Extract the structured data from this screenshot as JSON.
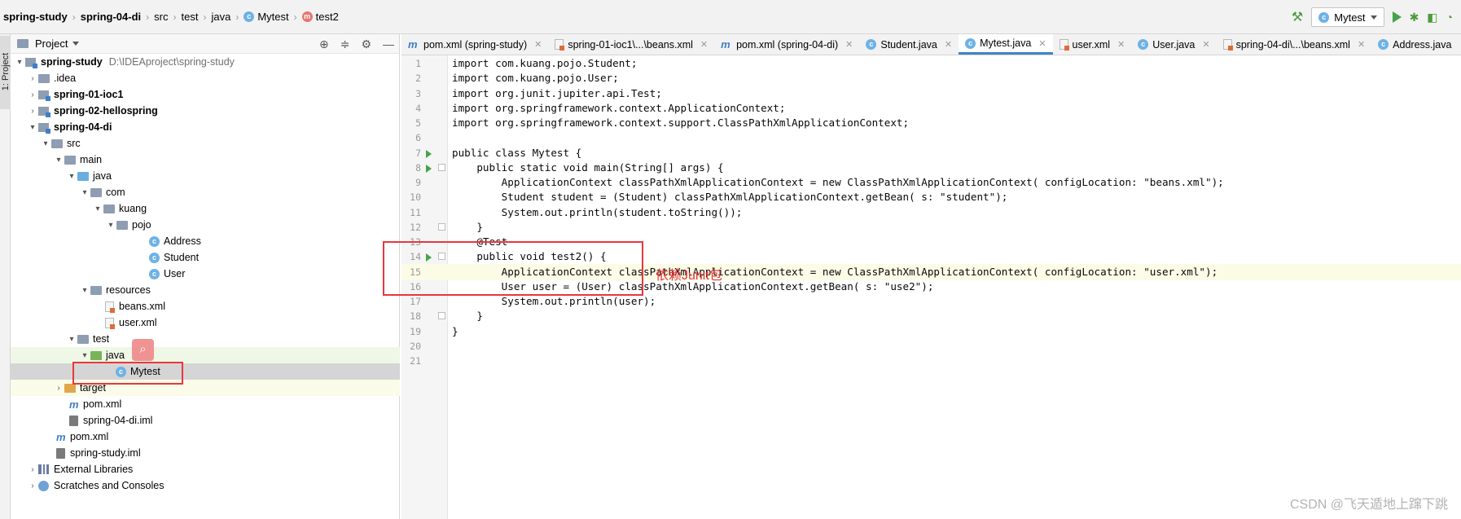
{
  "breadcrumb": {
    "items": [
      "spring-study",
      "spring-04-di",
      "src",
      "test",
      "java",
      "Mytest",
      "test2"
    ]
  },
  "toolbar": {
    "run_config": "Mytest"
  },
  "sidebar": {
    "stripe_label": "1: Project",
    "header": "Project",
    "tree": {
      "root": {
        "name": "spring-study",
        "path": "D:\\IDEAproject\\spring-study"
      },
      "idea": ".idea",
      "ioc1": "spring-01-ioc1",
      "hellospring": "spring-02-hellospring",
      "di": "spring-04-di",
      "src": "src",
      "main": "main",
      "java": "java",
      "com": "com",
      "kuang": "kuang",
      "pojo": "pojo",
      "address": "Address",
      "student": "Student",
      "user": "User",
      "resources": "resources",
      "beans_xml": "beans.xml",
      "user_xml": "user.xml",
      "test": "test",
      "test_java": "java",
      "mytest": "Mytest",
      "target": "target",
      "pom_di": "pom.xml",
      "iml_di": "spring-04-di.iml",
      "pom_root": "pom.xml",
      "iml_root": "spring-study.iml",
      "ext_libs": "External Libraries",
      "scratches": "Scratches and Consoles"
    }
  },
  "tabs": [
    {
      "label": "pom.xml (spring-study)",
      "icon": "maven"
    },
    {
      "label": "spring-01-ioc1\\...\\beans.xml",
      "icon": "xml"
    },
    {
      "label": "pom.xml (spring-04-di)",
      "icon": "maven"
    },
    {
      "label": "Student.java",
      "icon": "class"
    },
    {
      "label": "Mytest.java",
      "icon": "class",
      "active": true
    },
    {
      "label": "user.xml",
      "icon": "xml"
    },
    {
      "label": "User.java",
      "icon": "class"
    },
    {
      "label": "spring-04-di\\...\\beans.xml",
      "icon": "xml"
    },
    {
      "label": "Address.java",
      "icon": "class"
    }
  ],
  "editor": {
    "lines": [
      "import com.kuang.pojo.Student;",
      "import com.kuang.pojo.User;",
      "import org.junit.jupiter.api.Test;",
      "import org.springframework.context.ApplicationContext;",
      "import org.springframework.context.support.ClassPathXmlApplicationContext;",
      "",
      "public class Mytest {",
      "    public static void main(String[] args) {",
      "        ApplicationContext classPathXmlApplicationContext = new ClassPathXmlApplicationContext( configLocation: \"beans.xml\");",
      "        Student student = (Student) classPathXmlApplicationContext.getBean( s: \"student\");",
      "        System.out.println(student.toString());",
      "    }",
      "    @Test",
      "    public void test2() {",
      "        ApplicationContext classPathXmlApplicationContext = new ClassPathXmlApplicationContext( configLocation: \"user.xml\");",
      "        User user = (User) classPathXmlApplicationContext.getBean( s: \"use2\");",
      "        System.out.println(user);",
      "    }",
      "}",
      "",
      ""
    ],
    "annotation": "依赖Junit包"
  },
  "watermark": "CSDN @飞天遁地上蹿下跳",
  "colors": {
    "highlight_box": "#e8373c",
    "active_tab_underline": "#4083c9",
    "keyword": "#0033b3",
    "string": "#067d17"
  }
}
